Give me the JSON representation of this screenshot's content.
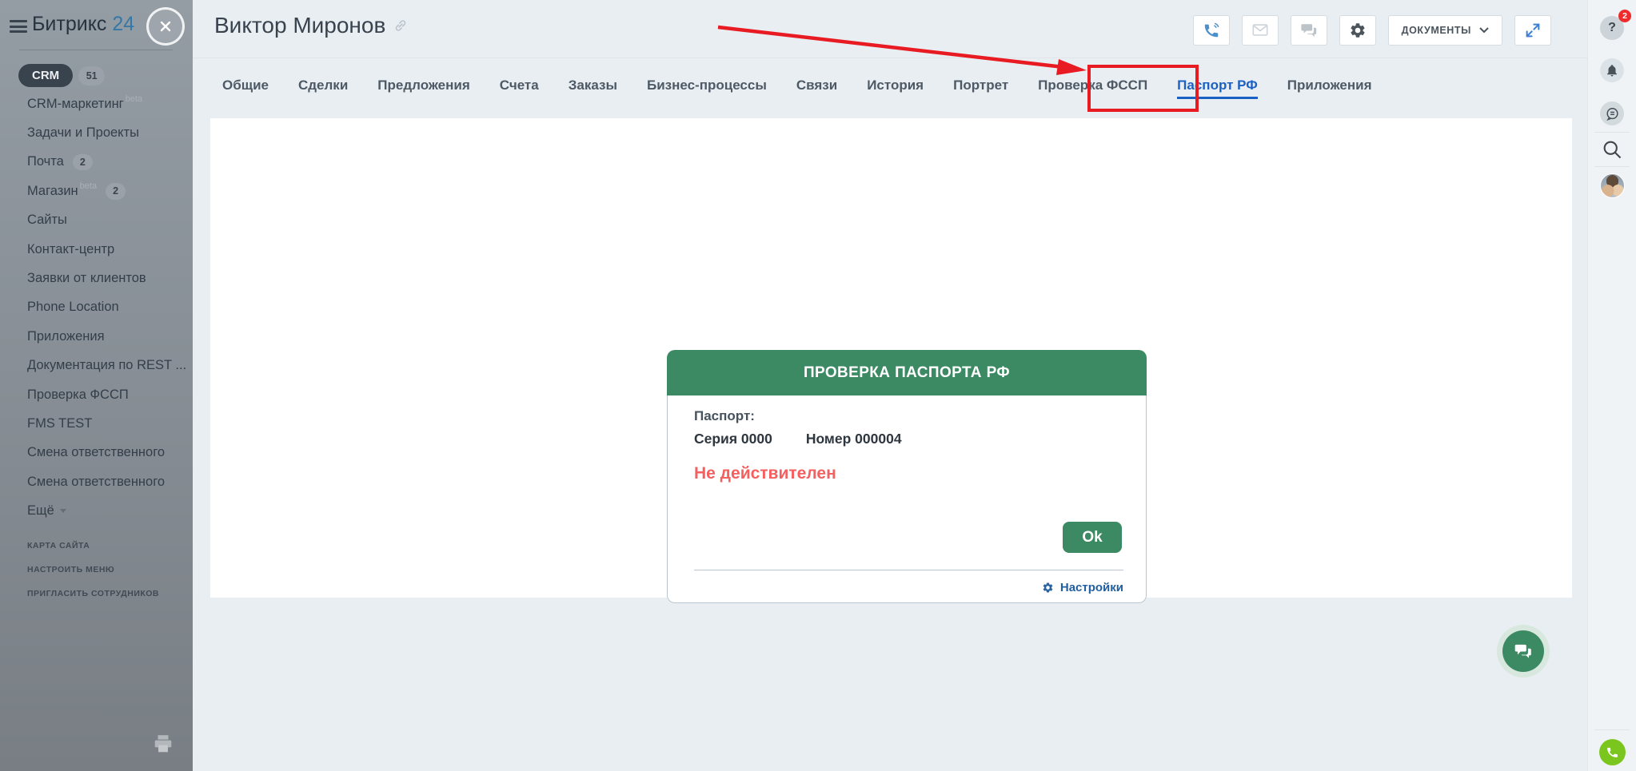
{
  "sidebar": {
    "logo": {
      "brand": "Битрикс",
      "number": "24"
    },
    "crm": {
      "label": "CRM",
      "count": "51"
    },
    "items": [
      {
        "label": "CRM-маркетинг",
        "sup": "beta"
      },
      {
        "label": "Задачи и Проекты"
      },
      {
        "label": "Почта",
        "badge": "2"
      },
      {
        "label": "Магазин",
        "sup": "beta",
        "badge": "2"
      },
      {
        "label": "Сайты"
      },
      {
        "label": "Контакт-центр"
      },
      {
        "label": "Заявки от клиентов"
      },
      {
        "label": "Phone Location"
      },
      {
        "label": "Приложения"
      },
      {
        "label": "Документация по REST ..."
      },
      {
        "label": "Проверка ФССП"
      },
      {
        "label": "FMS TEST"
      },
      {
        "label": "Смена ответственного"
      },
      {
        "label": "Смена ответственного"
      },
      {
        "label": "Ещё"
      }
    ],
    "footer_links": [
      "КАРТА САЙТА",
      "НАСТРОИТЬ МЕНЮ",
      "ПРИГЛАСИТЬ СОТРУДНИКОВ"
    ]
  },
  "header": {
    "title": "Виктор Миронов",
    "documents_label": "ДОКУМЕНТЫ"
  },
  "tabs": [
    {
      "label": "Общие"
    },
    {
      "label": "Сделки"
    },
    {
      "label": "Предложения"
    },
    {
      "label": "Счета"
    },
    {
      "label": "Заказы"
    },
    {
      "label": "Бизнес-процессы"
    },
    {
      "label": "Связи"
    },
    {
      "label": "История"
    },
    {
      "label": "Портрет"
    },
    {
      "label": "Проверка ФССП"
    },
    {
      "label": "Паспорт РФ",
      "active": true
    },
    {
      "label": "Приложения"
    }
  ],
  "modal": {
    "title": "ПРОВЕРКА ПАСПОРТА РФ",
    "passport_label": "Паспорт:",
    "series": "Серия 0000",
    "number": "Номер 000004",
    "status": "Не действителен",
    "ok_label": "Ok",
    "settings_label": "Настройки"
  },
  "rightrail": {
    "help_glyph": "?",
    "help_badge": "2"
  },
  "colors": {
    "page-bg": "#e9eef2",
    "green": "#3c8a63",
    "red-status": "#f55f5f",
    "annotation-red": "#e81b23",
    "tab-blue": "#1b61c4",
    "link-blue": "#225f9f",
    "brand-blue": "#3478a8",
    "lime": "#7bc51f"
  }
}
